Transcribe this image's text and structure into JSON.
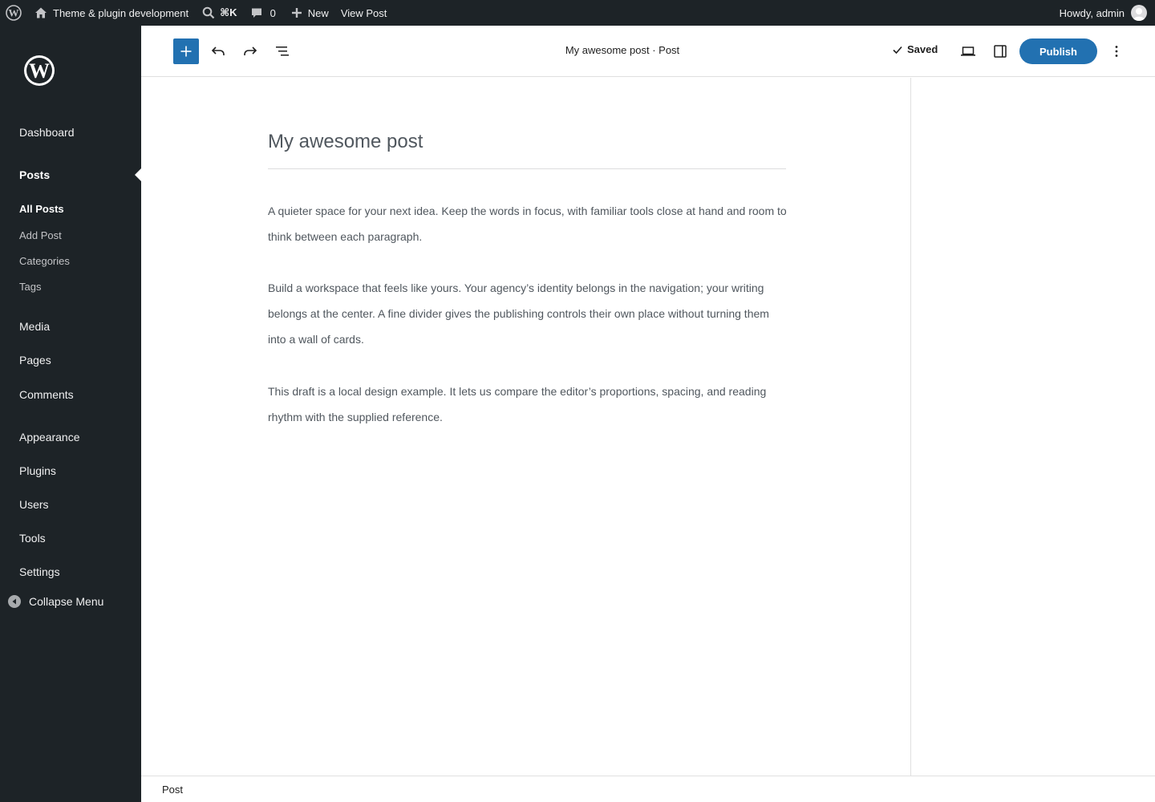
{
  "admin_bar": {
    "site_name": "Theme & plugin development",
    "search_shortcut": "⌘K",
    "comments_count": "0",
    "new_label": "New",
    "view_post_label": "View Post",
    "howdy": "Howdy, admin"
  },
  "sidebar": {
    "items": {
      "dashboard": "Dashboard",
      "posts": "Posts",
      "media": "Media",
      "pages": "Pages",
      "comments": "Comments",
      "appearance": "Appearance",
      "plugins": "Plugins",
      "users": "Users",
      "tools": "Tools",
      "settings": "Settings"
    },
    "posts_submenu": {
      "all_posts": "All Posts",
      "add_post": "Add Post",
      "categories": "Categories",
      "tags": "Tags"
    },
    "collapse_label": "Collapse Menu"
  },
  "header": {
    "document_title": "My awesome post · Post",
    "saved_label": "Saved",
    "publish_label": "Publish"
  },
  "post": {
    "title": "My awesome post",
    "paragraphs": [
      "A quieter space for your next idea. Keep the words in focus, with familiar tools close at hand and room to think between each paragraph.",
      "Build a workspace that feels like yours. Your agency’s identity belongs in the navigation; your writing belongs at the center. A fine divider gives the publishing controls their own place without turning them into a wall of cards.",
      "This draft is a local design example. It lets us compare the editor’s proportions, spacing, and reading rhythm with the supplied reference."
    ]
  },
  "footer": {
    "breadcrumb": "Post"
  },
  "colors": {
    "admin_dark": "#1d2327",
    "accent_blue": "#2271b1",
    "body_text": "#50575e"
  }
}
